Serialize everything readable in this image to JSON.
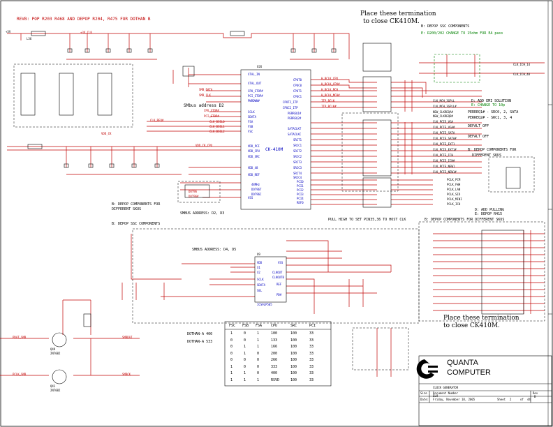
{
  "header": {
    "rev_note": "REVB: POP R203 R468 AND DEPOP R204, R475 FOR DOTHAN B"
  },
  "notes": {
    "place_top": "Place these termination",
    "place_top_2": "to close CK410M.",
    "place_bottom": "Place these termination",
    "place_bottom_2": "to close CK410M.",
    "depop_ssc_a": "B: DEPOP SSC COMPONENTS",
    "change_15": "E: R200/202 CHANGE TO 15ohm FOR EA pass",
    "add_emi": "D: ADD EMI SOLUTION",
    "change_10p": "E: CHANGE TO 10p",
    "perreq1": "PERREQ1# - SRC0, 2, SATA",
    "perreq2": "PERREQ2# - SRC1, 3, 4",
    "default_off_1": "DEFALT OFF",
    "default_off_2": "DEFALT OFF",
    "depop_diff_1": "B: DEPOP COMPONENTS FOR",
    "depop_diff_1b": "DIFFERENT SKUS",
    "depop_diff_2": "B: DEPOP COMPONENTS FOR",
    "depop_diff_2b": "DIFFERENT SKUS",
    "depop_ssc_b": "B: DEPOP SSC COMPONENTS",
    "pull_high": "PULL HIGH TO SET PIN35,36 TO HOST CLK",
    "depop_diff_3": "B: DEPOP COMPONENTS FOR DIFFERENT SKUS",
    "add_pulling": "D: ADD PULLING",
    "depop_r415": "E: DEPOP R415",
    "smbus_d2d3": "SMBUS ADDRESS: D2, D3",
    "smbus_d4d5": "SMBUS ADDRESS: D4, D5",
    "smbus_address_d2": "SMbus address D2",
    "dothan_400": "DOTHAN-A 400",
    "dothan_533": "DOTHAN-A 533"
  },
  "chip": {
    "name": "CK-410M",
    "ref": "U26",
    "left_pins": [
      "XTAL_IN",
      "XTAL_OUT",
      "CPU_STOP#",
      "PCI_STOP#",
      "PWRDWN#",
      "SCLK",
      "SDATA",
      "FSA",
      "FSB",
      "FSC",
      "VDD_PCI",
      "VDD_CPU",
      "VDD_SRC",
      "VDD_48",
      "VDD_REF",
      "VSS"
    ],
    "right_pins": [
      "CPUT0",
      "CPUC0",
      "CPUT1",
      "CPUC1",
      "CPUT2_ITP",
      "CPUC2_ITP",
      "PERREQ1#",
      "PERREQ2#",
      "SATACLKT",
      "SATACLKC",
      "SRCT1",
      "SRCC1",
      "SRCT2",
      "SRCC2",
      "SRCT3",
      "SRCC3",
      "SRCT4",
      "SRCC4",
      "PCI0",
      "PCI1",
      "PCI2",
      "PCI3",
      "PCI4",
      "REF0",
      "48MHz",
      "DOT96T",
      "DOT96C"
    ]
  },
  "signals_left": [
    "+3V",
    "L36",
    "SMB_DATA",
    "SMB_CLK",
    "CPU_STOP#",
    "PCI_STOP#",
    "CLK_REQ#",
    "VDD_CK",
    "+3V_CLK",
    "VDD_CK_CPU",
    "DOT96",
    "DOT96#"
  ],
  "signals_right": [
    "H_BCLK_CPU",
    "H_BCLK_CPU#",
    "H_BCLK_MCH",
    "H_BCLK_MCH#",
    "CLK_MCH_3GPLL",
    "CLK_MCH_3GPLL#",
    "CLK_PCIE_VGA",
    "CLK_PCIE_VGA#",
    "CLK_PCIE_SATA",
    "CLK_PCIE_SATA#",
    "CLK_PCIE_EXT1",
    "CLK_PCIE_EXT1#",
    "CLK_PCIE_ICH",
    "CLK_PCIE_ICH#",
    "CLK_PCIE_NEW1",
    "CLK_PCIE_NEW1#",
    "PCLK_PCM",
    "PCLK_FWH",
    "PCLK_LAN",
    "PCLK_SIO",
    "PCLK_MINI",
    "PCLK_ICH",
    "CLK_ICH_14",
    "CLK_ICH_48",
    "NEW_CLKREQA#",
    "NEW_CLKREQB#",
    "ITP_BCLK",
    "ITP_BCLK#",
    "CLK_BSEL0",
    "CLK_BSEL1",
    "CLK_BSEL2"
  ],
  "ssc_chip": {
    "name": "ICS9LP505",
    "ref": "U9",
    "pins": [
      "VDD",
      "VSS",
      "X1",
      "X2",
      "SCLK",
      "SDATA",
      "SEL",
      "CLKOUT",
      "CLKOUTB",
      "REF",
      "PD#"
    ]
  },
  "fsb_table": {
    "headers": [
      "FSC",
      "FSB",
      "FSA",
      "CPU",
      "SRC",
      "PCI"
    ],
    "rows": [
      [
        "1",
        "0",
        "1",
        "100",
        "100",
        "33"
      ],
      [
        "0",
        "0",
        "1",
        "133",
        "100",
        "33"
      ],
      [
        "0",
        "1",
        "1",
        "166",
        "100",
        "33"
      ],
      [
        "0",
        "1",
        "0",
        "200",
        "100",
        "33"
      ],
      [
        "0",
        "0",
        "0",
        "266",
        "100",
        "33"
      ],
      [
        "1",
        "0",
        "0",
        "333",
        "100",
        "33"
      ],
      [
        "1",
        "1",
        "0",
        "400",
        "100",
        "33"
      ],
      [
        "1",
        "1",
        "1",
        "RSVD",
        "100",
        "33"
      ]
    ]
  },
  "title_block": {
    "company": "QUANTA",
    "company2": "COMPUTER",
    "title": "CLOCK GENERATOR",
    "size_label": "Size",
    "doc_label": "Document Number",
    "doc_value": "EL9",
    "rev_label": "Rev",
    "rev_value": "B",
    "date_label": "Date:",
    "date_value": "Friday, November 18, 2005",
    "sheet_label": "Sheet",
    "sheet_value": "2",
    "of_label": "of",
    "of_value": "44"
  },
  "transistors": [
    {
      "ref": "Q49",
      "part": "2N7002",
      "in": "PDAT_SMB",
      "out": "SMBDAT"
    },
    {
      "ref": "Q41",
      "part": "2N7002",
      "in": "PCLK_SMB",
      "out": "SMBCK"
    }
  ],
  "colors": {
    "wire": "#c00000",
    "text": "#000000",
    "net": "#0000c0",
    "note": "#008000",
    "border": "#000000"
  }
}
